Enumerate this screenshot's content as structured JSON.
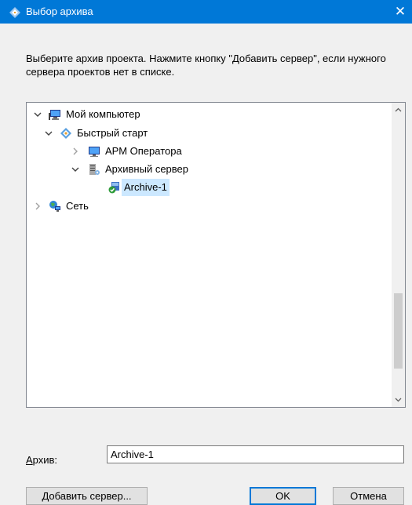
{
  "window": {
    "title": "Выбор архива",
    "close_symbol": "✕",
    "accent": "#0078d7"
  },
  "instruction": "Выберите архив проекта. Нажмите кнопку \"Добавить сервер\", если нужного сервера проектов нет в списке.",
  "tree": {
    "my_computer": "Мой компьютер",
    "quick_start": "Быстрый старт",
    "arm_operator": "АРМ Оператора",
    "archive_server": "Архивный сервер",
    "archive_1": "Archive-1",
    "network": "Сеть",
    "selected": "Archive-1",
    "selection_color": "#cce8ff"
  },
  "archive_field": {
    "label_underlined": "А",
    "label_rest": "рхив:",
    "value": "Archive-1"
  },
  "buttons": {
    "add_server_underlined": "Д",
    "add_server_rest": "обавить сервер...",
    "ok": "OK",
    "cancel": "Отмена"
  },
  "icons": [
    "app-icon",
    "close-icon",
    "computer-icon",
    "quick-start-icon",
    "monitor-icon",
    "server-icon",
    "archive-icon",
    "network-icon",
    "chevron-down-icon",
    "chevron-right-icon",
    "scroll-up-icon",
    "scroll-down-icon"
  ]
}
